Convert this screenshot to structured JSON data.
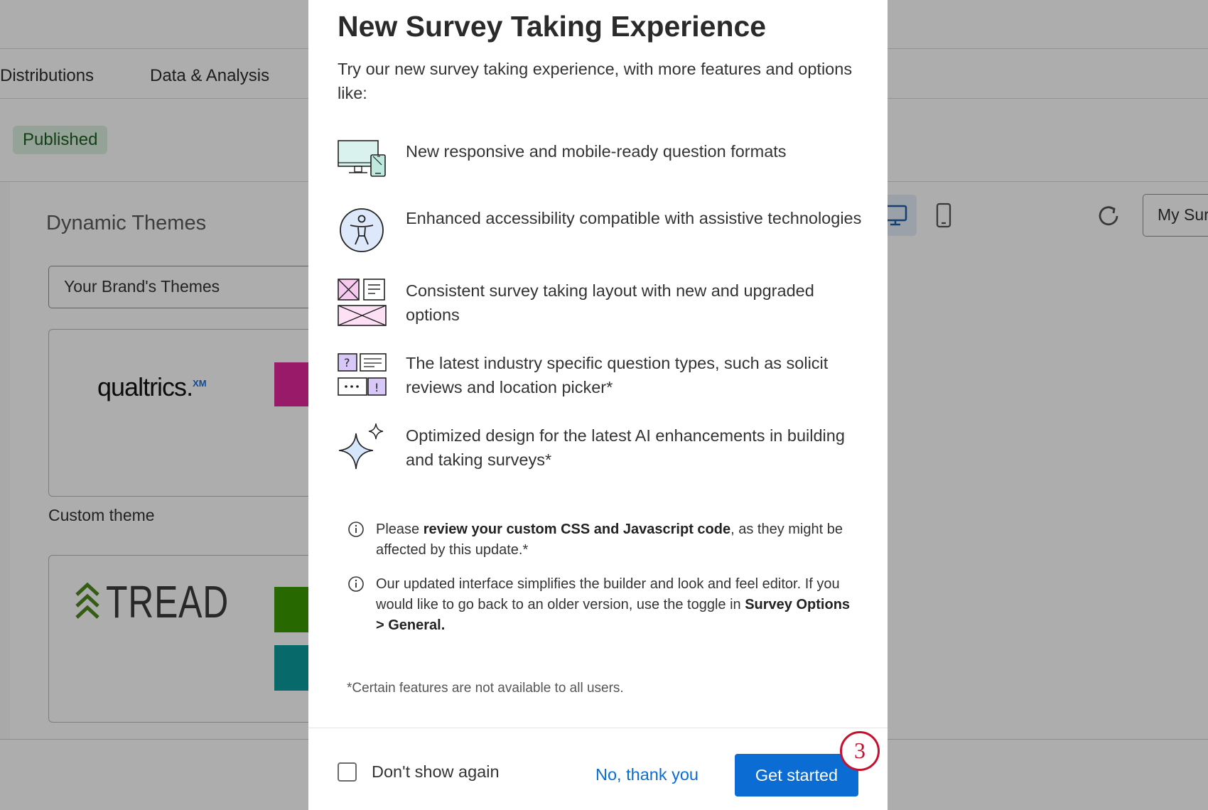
{
  "background": {
    "nav_tabs": [
      "Distributions",
      "Data & Analysis"
    ],
    "status_badge": "Published",
    "panel_title": "Dynamic Themes",
    "theme_select_value": "Your Brand's Themes",
    "theme_cards": [
      {
        "logo_text": "qualtrics",
        "logo_sup": "XM",
        "label": "Custom theme"
      },
      {
        "logo_text": "TREAD"
      }
    ],
    "preview_select_value": "My Sur"
  },
  "modal": {
    "title": "New Survey Taking Experience",
    "intro": "Try our new survey taking experience, with more features and options like:",
    "features": [
      {
        "icon": "responsive-devices-icon",
        "text": "New responsive and mobile-ready question formats"
      },
      {
        "icon": "accessibility-icon",
        "text": "Enhanced accessibility compatible with assistive technologies"
      },
      {
        "icon": "layout-icon",
        "text": "Consistent survey taking layout with new and upgraded options"
      },
      {
        "icon": "question-types-icon",
        "text": "The latest industry specific question types, such as solicit reviews and location picker*"
      },
      {
        "icon": "ai-sparkle-icon",
        "text": "Optimized design for the latest AI enhancements in building and taking surveys*"
      }
    ],
    "notes": [
      {
        "pre": "Please ",
        "bold": "review your custom CSS and Javascript code",
        "post": ", as they might be affected by this update.*"
      },
      {
        "pre": "Our updated interface simplifies the builder and look and feel editor. If you would like to go back to an older version, use the toggle in ",
        "bold": "Survey Options > General.",
        "post": ""
      }
    ],
    "footnote": "*Certain features are not available to all users.",
    "checkbox_label": "Don't show again",
    "secondary_button": "No, thank you",
    "primary_button": "Get started"
  },
  "step_badge": "3",
  "colors": {
    "primary_blue": "#0b6cd4",
    "step_red": "#c8102e",
    "published_bg": "#dcefe0"
  }
}
